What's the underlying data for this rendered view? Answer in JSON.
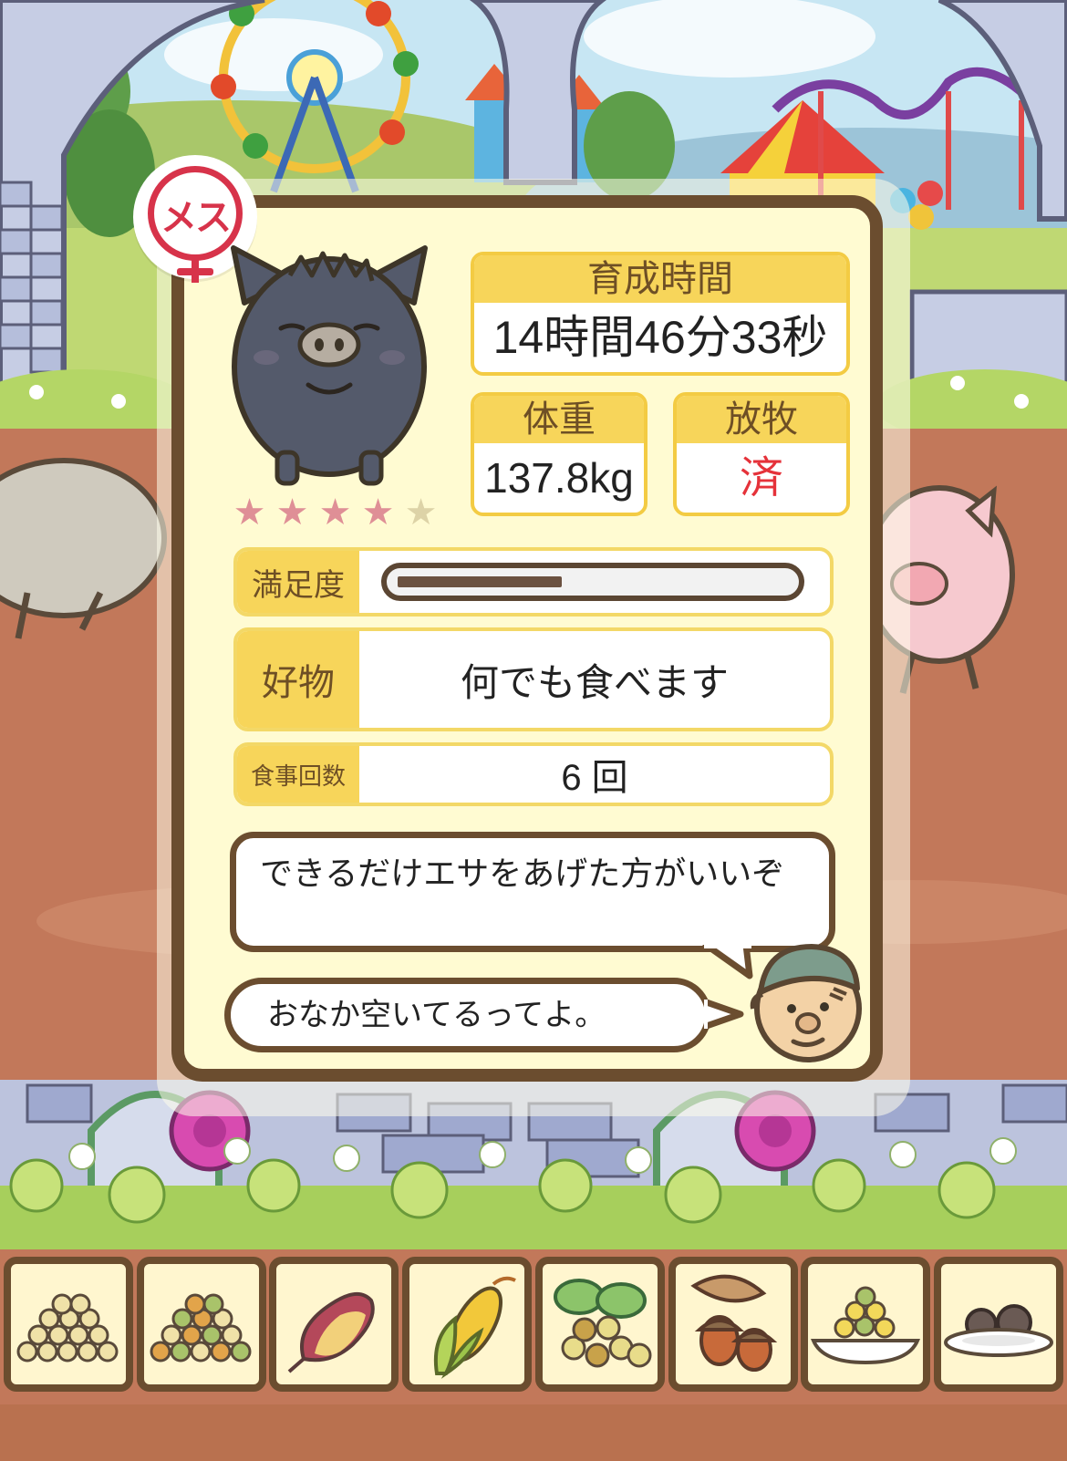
{
  "gender": {
    "label": "メス",
    "color": "#d7334a"
  },
  "pig": {
    "name_icon": "black-pig-icon",
    "rating": 4,
    "rating_max": 5
  },
  "stats": {
    "growth_time": {
      "label": "育成時間",
      "value": "14時間46分33秒"
    },
    "weight": {
      "label": "体重",
      "value": "137.8kg"
    },
    "grazing": {
      "label": "放牧",
      "value": "済",
      "value_color": "#e5323a"
    }
  },
  "satisfaction": {
    "label": "満足度",
    "level": 0.42
  },
  "favorite": {
    "label": "好物",
    "value": "何でも食べます"
  },
  "meals": {
    "label": "食事回数",
    "value": "6 回"
  },
  "advice": {
    "text": "できるだけエサをあげた方がいいぞ"
  },
  "status_message": {
    "text": "おなか空いてるってよ。"
  },
  "food_items": [
    {
      "icon": "soybeans-icon"
    },
    {
      "icon": "mixed-beans-icon"
    },
    {
      "icon": "sweet-potato-icon"
    },
    {
      "icon": "corn-icon"
    },
    {
      "icon": "leaf-nuts-icon"
    },
    {
      "icon": "acorn-icon"
    },
    {
      "icon": "feed-plate-icon"
    },
    {
      "icon": "meatball-plate-icon"
    }
  ]
}
